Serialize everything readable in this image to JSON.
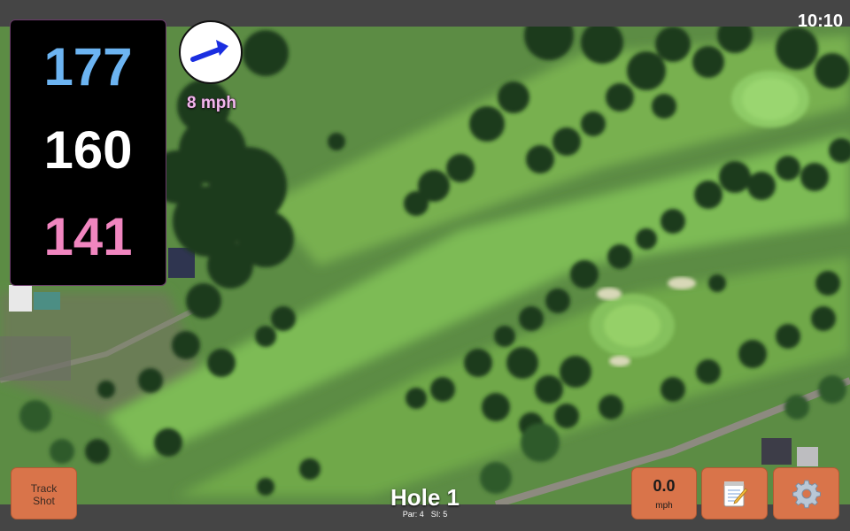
{
  "status_bar": {
    "time": "10:10"
  },
  "yardages": {
    "back": "177",
    "middle": "160",
    "front": "141"
  },
  "wind": {
    "speed": "8 mph",
    "icon": "arrow-icon"
  },
  "hole": {
    "title": "Hole 1",
    "par": "Par: 4",
    "stroke_index": "SI: 5"
  },
  "buttons": {
    "track_shot_line1": "Track",
    "track_shot_line2": "Shot",
    "speed_value": "0.0",
    "speed_unit": "mph",
    "notes_icon": "notepad-icon",
    "settings_icon": "gear-icon"
  },
  "colors": {
    "back_yardage": "#6cb4f2",
    "middle_yardage": "#ffffff",
    "front_yardage": "#f186c0",
    "button": "#d9744a",
    "wind_arrow": "#1a2ee0"
  }
}
